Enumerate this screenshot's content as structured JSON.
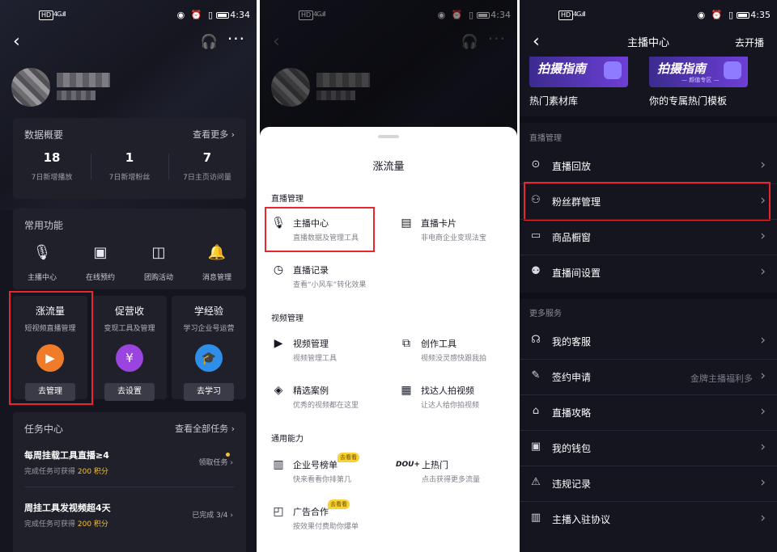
{
  "status": {
    "hd": "HD",
    "signal": "4G.ıll",
    "icons": "◉ ⏰ ▯",
    "time_1": "4:34",
    "time_2": "4:34",
    "time_3": "4:35"
  },
  "screen1": {
    "data_card": {
      "title": "数据概要",
      "more": "查看更多 ›",
      "stats": [
        {
          "value": "18",
          "label": "7日新增播放"
        },
        {
          "value": "1",
          "label": "7日新增粉丝"
        },
        {
          "value": "7",
          "label": "7日主页访问量"
        }
      ]
    },
    "func_card": {
      "title": "常用功能",
      "items": [
        {
          "label": "主播中心",
          "icon": "mic-icon"
        },
        {
          "label": "在线预约",
          "icon": "calendar-icon"
        },
        {
          "label": "团购活动",
          "icon": "coupon-icon"
        },
        {
          "label": "消息管理",
          "icon": "bell-icon"
        }
      ]
    },
    "promos": [
      {
        "title": "涨流量",
        "sub": "短视频直播管理",
        "button": "去管理",
        "color": "#f07b28"
      },
      {
        "title": "促营收",
        "sub": "变现工具及管理",
        "button": "去设置",
        "color": "#9b45e0"
      },
      {
        "title": "学经验",
        "sub": "学习企业号运营",
        "button": "去学习",
        "color": "#2f8ee8"
      }
    ],
    "tasks": {
      "title": "任务中心",
      "more": "查看全部任务 ›",
      "items": [
        {
          "title": "每周挂载工具直播≥4",
          "sub_prefix": "完成任务可获得 ",
          "points": "200 积分",
          "status": "领取任务 ›"
        },
        {
          "title": "周挂工具发视频超4天",
          "sub_prefix": "完成任务可获得 ",
          "points": "200 积分",
          "status": "已完成 3/4 ›"
        }
      ]
    }
  },
  "screen2": {
    "sheet_title": "涨流量",
    "sections": [
      {
        "title": "直播管理",
        "items": [
          {
            "title": "主播中心",
            "sub": "直播数据及管理工具",
            "icon": "mic-icon"
          },
          {
            "title": "直播卡片",
            "sub": "非电商企业变现法宝",
            "icon": "card-icon"
          },
          {
            "title": "直播记录",
            "sub": "查看“小风车”转化效果",
            "icon": "history-icon"
          }
        ]
      },
      {
        "title": "视频管理",
        "items": [
          {
            "title": "视频管理",
            "sub": "视频管理工具",
            "icon": "video-icon"
          },
          {
            "title": "创作工具",
            "sub": "视频没灵感快跟我拍",
            "icon": "create-icon"
          },
          {
            "title": "精选案例",
            "sub": "优秀的视频都在这里",
            "icon": "layers-icon"
          },
          {
            "title": "找达人拍视频",
            "sub": "让达人给你拍视频",
            "icon": "doc-icon"
          }
        ]
      },
      {
        "title": "通用能力",
        "items": [
          {
            "title": "企业号榜单",
            "sub": "快来看看你排第几",
            "icon": "chart-icon",
            "tag": "去看看"
          },
          {
            "title": "上热门",
            "sub": "点击获得更多流量",
            "icon": "dou-icon",
            "logo": "DOU+"
          },
          {
            "title": "广告合作",
            "sub": "按效果付费助你爆单",
            "icon": "ad-icon",
            "tag": "去看看"
          }
        ]
      }
    ]
  },
  "screen3": {
    "nav_title": "主播中心",
    "nav_right": "去开播",
    "banners": [
      {
        "title": "拍摄指南",
        "sub": "",
        "caption": "热门素材库"
      },
      {
        "title": "拍摄指南",
        "sub": "— 颜值专区 —",
        "caption": "你的专属热门模板"
      }
    ],
    "group1": "直播管理",
    "rows1": [
      {
        "label": "直播回放",
        "icon": "play-icon",
        "right": ""
      },
      {
        "label": "粉丝群管理",
        "icon": "group-icon",
        "right": ""
      },
      {
        "label": "商品橱窗",
        "icon": "shop-icon",
        "right": ""
      },
      {
        "label": "直播间设置",
        "icon": "user-settings-icon",
        "right": ""
      }
    ],
    "group2": "更多服务",
    "rows2": [
      {
        "label": "我的客服",
        "icon": "headset-icon",
        "right": ""
      },
      {
        "label": "签约申请",
        "icon": "sign-icon",
        "right": "金牌主播福利多"
      },
      {
        "label": "直播攻略",
        "icon": "guide-icon",
        "right": ""
      },
      {
        "label": "我的钱包",
        "icon": "wallet-icon",
        "right": ""
      },
      {
        "label": "违规记录",
        "icon": "warning-icon",
        "right": ""
      },
      {
        "label": "主播入驻协议",
        "icon": "book-icon",
        "right": ""
      }
    ]
  }
}
